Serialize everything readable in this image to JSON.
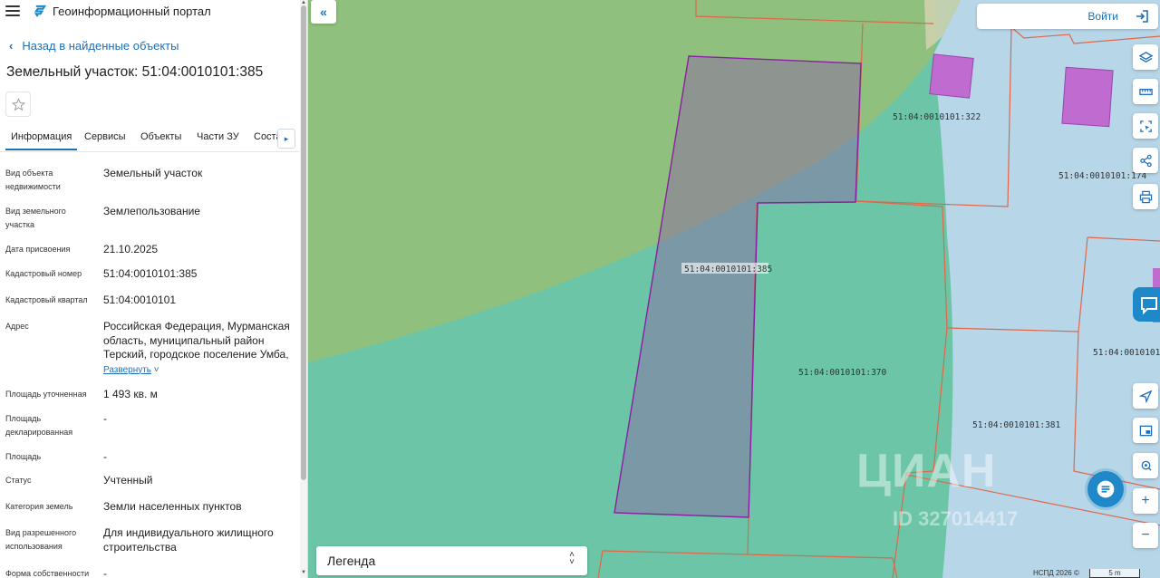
{
  "header": {
    "portal_title": "Геоинформационный портал",
    "menu_icon": "menu-icon",
    "logo_icon": "portal-logo-icon"
  },
  "nav": {
    "back_label": "Назад в найденные объекты"
  },
  "object": {
    "title": "Земельный участок: 51:04:0010101:385"
  },
  "tabs": [
    {
      "label": "Информация",
      "active": true
    },
    {
      "label": "Сервисы"
    },
    {
      "label": "Объекты"
    },
    {
      "label": "Части ЗУ"
    },
    {
      "label": "Соста"
    }
  ],
  "fields": [
    {
      "label": "Вид объекта недвижимости",
      "value": "Земельный участок"
    },
    {
      "label": "Вид земельного участка",
      "value": "Землепользование"
    },
    {
      "label": "Дата присвоения",
      "value": "21.10.2025"
    },
    {
      "label": "Кадастровый номер",
      "value": "51:04:0010101:385"
    },
    {
      "label": "Кадастровый квартал",
      "value": "51:04:0010101"
    },
    {
      "label": "Адрес",
      "value": "Российская Федерация, Мурманская область, муниципальный район Терский, городское поселение Умба,",
      "expand": "Развернуть"
    },
    {
      "label": "Площадь уточненная",
      "value": "1 493 кв. м"
    },
    {
      "label": "Площадь декларированная",
      "value": "-"
    },
    {
      "label": "Площадь",
      "value": "-"
    },
    {
      "label": "Статус",
      "value": "Учтенный"
    },
    {
      "label": "Категория земель",
      "value": "Земли населенных пунктов"
    },
    {
      "label": "Вид разрешенного использования",
      "value": "Для индивидуального жилищного строительства"
    },
    {
      "label": "Форма собственности",
      "value": "-"
    }
  ],
  "map": {
    "login_label": "Войти",
    "legend_label": "Легенда",
    "plot_labels": {
      "main": "51:04:0010101:385",
      "p322": "51:04:0010101:322",
      "p174": "51:04:0010101:174",
      "p370": "51:04:0010101:370",
      "p381": "51:04:0010101:381",
      "p_right": "51:04:0010101"
    },
    "watermark": "ЦИАН",
    "watermark_id": "ID 327014417",
    "attribution": "НСПД 2026 ©",
    "scale": "5 m",
    "tools": [
      "layers-icon",
      "ruler-icon",
      "select-area-icon",
      "share-icon",
      "print-icon",
      "locate-icon",
      "minimap-icon",
      "search-location-icon",
      "zoom-in-icon",
      "zoom-out-icon"
    ],
    "colors": {
      "green_zone": "#8fc07e",
      "teal_zone": "#6cc5a6",
      "water": "#b7d6e8",
      "selected_plot": "#8f62a8",
      "plot_border": "#e0664a",
      "building": "#c06bd0",
      "accent": "#1f6fb8"
    }
  }
}
